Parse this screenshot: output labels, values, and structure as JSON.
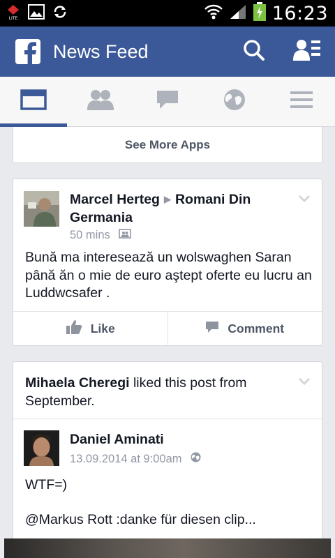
{
  "status_bar": {
    "time": "16:23"
  },
  "header": {
    "title": "News Feed"
  },
  "apps": {
    "see_more_label": "See More Apps"
  },
  "post1": {
    "author": "Marcel Herteg",
    "group": "Romani Din Germania",
    "time": "50 mins",
    "text": "Bună ma interesează un wolswaghen Saran până ăn o mie de euro aştept oferte eu lucru an Luddwcsafer ."
  },
  "actions": {
    "like": "Like",
    "comment": "Comment"
  },
  "post2": {
    "liker": "Mihaela Cheregi",
    "story_suffix": "liked this post from September.",
    "author": "Daniel Aminati",
    "time": "13.09.2014 at 9:00am",
    "line1": "WTF=)",
    "line2": "@Markus Rott :danke für diesen clip..."
  },
  "colors": {
    "brand": "#3b5998",
    "background": "#e9eaed",
    "muted_text": "#9197a3"
  }
}
